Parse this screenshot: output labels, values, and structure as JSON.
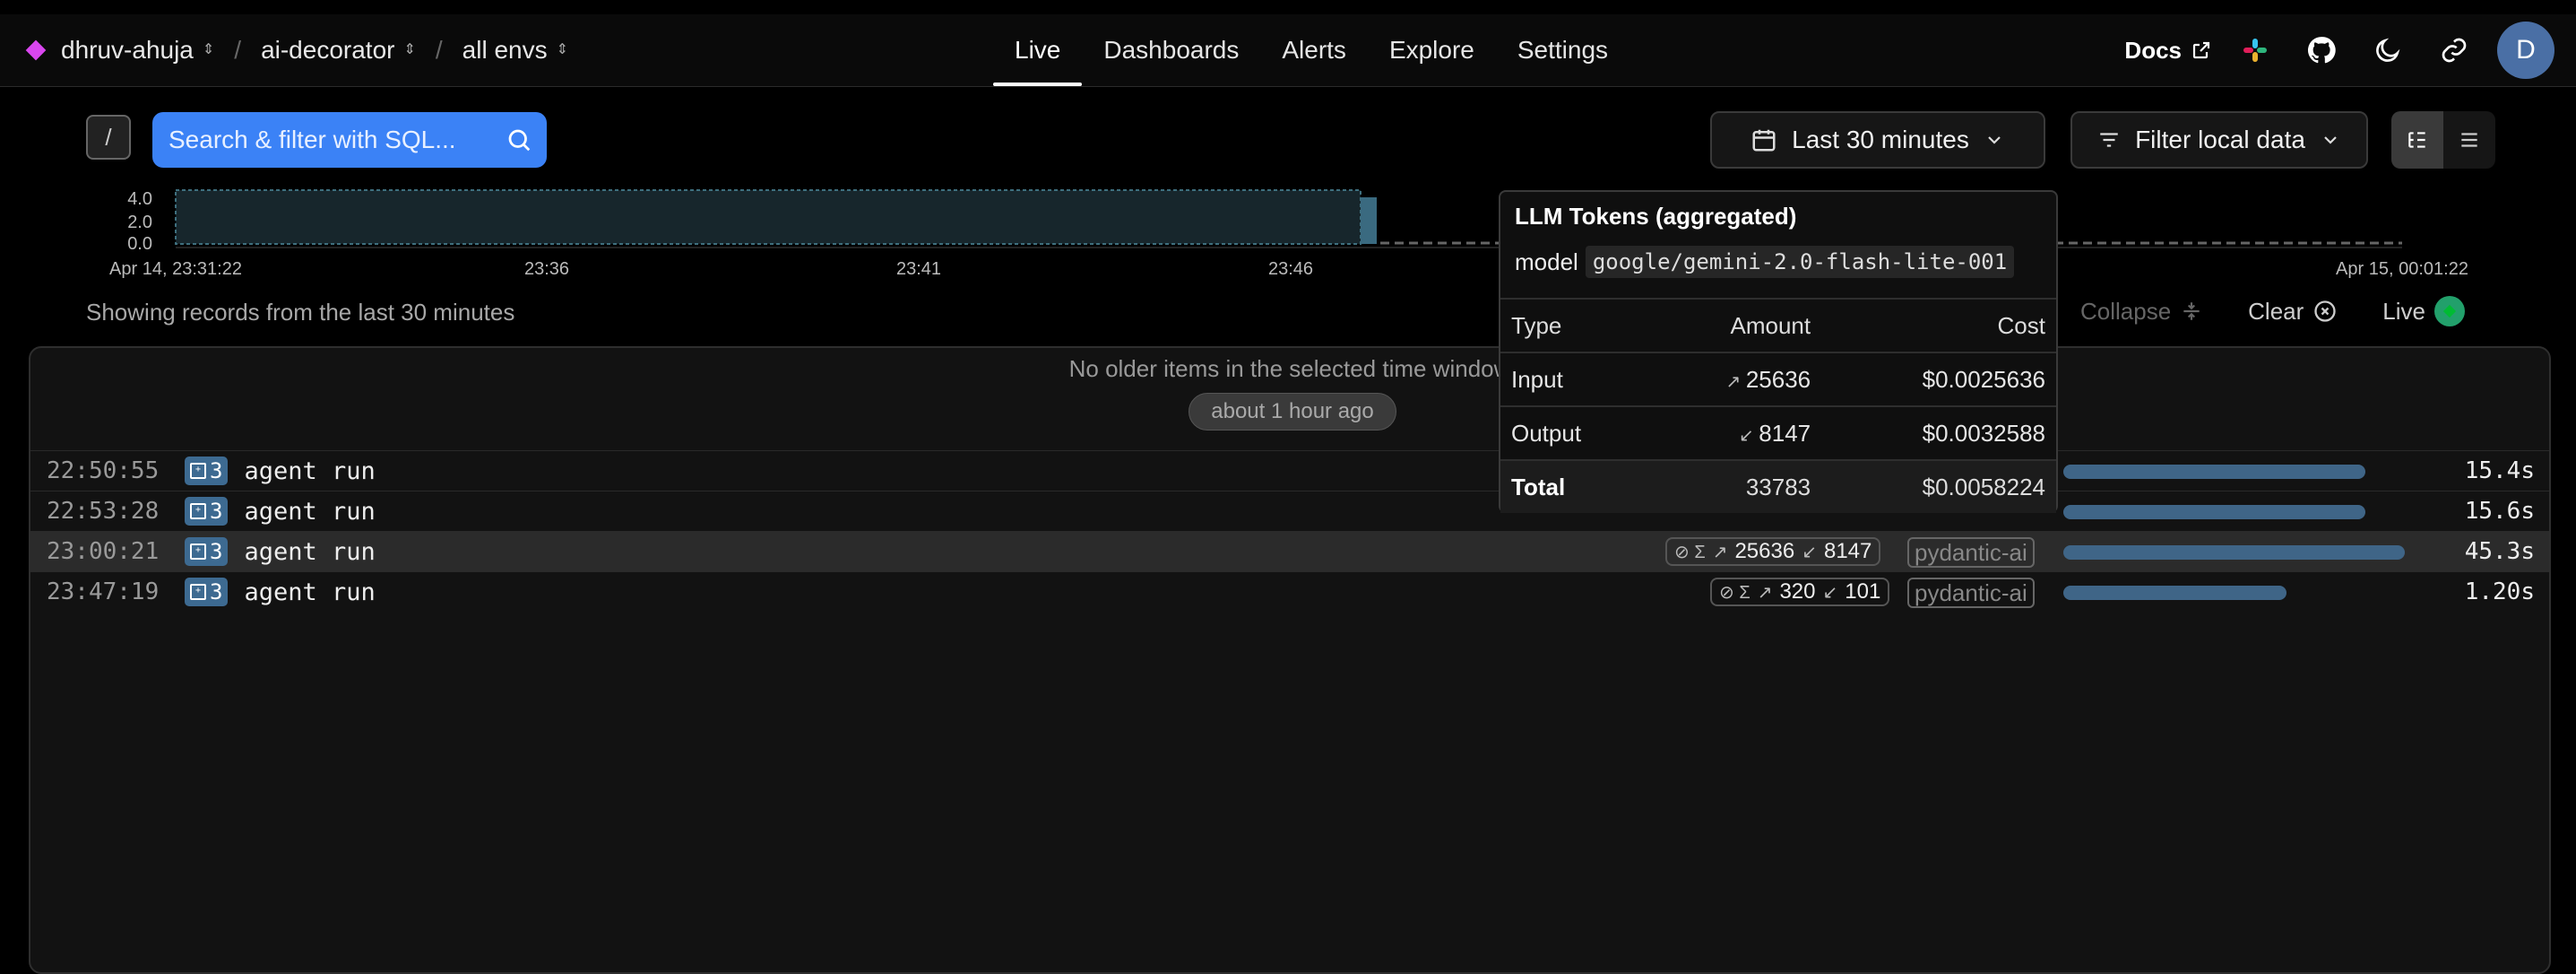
{
  "breadcrumb": {
    "org": "dhruv-ahuja",
    "project": "ai-decorator",
    "env": "all envs"
  },
  "nav": {
    "live": "Live",
    "dashboards": "Dashboards",
    "alerts": "Alerts",
    "explore": "Explore",
    "settings": "Settings"
  },
  "header_tools": {
    "docs": "Docs",
    "avatar_initial": "D"
  },
  "toolbar": {
    "slash_key": "/",
    "search_placeholder": "Search & filter with SQL...",
    "time_range": "Last 30 minutes",
    "filter_label": "Filter local data"
  },
  "histogram": {
    "y_ticks": [
      "4.0",
      "2.0",
      "0.0"
    ],
    "x_ticks": [
      "Apr 14, 23:31:22",
      "23:36",
      "23:41",
      "23:46",
      "Apr 15, 00:01:22"
    ]
  },
  "status": {
    "showing": "Showing records from the last 30 minutes",
    "collapse": "Collapse",
    "clear": "Clear",
    "live": "Live"
  },
  "panel": {
    "older": "No older items in the selected time window",
    "ago": "about 1 hour ago"
  },
  "rows": [
    {
      "time": "22:50:55",
      "count": "3",
      "name": "agent run",
      "tokens_in": "",
      "tokens_out": "",
      "tag": "",
      "duration": "15.4s",
      "bar": 0.77
    },
    {
      "time": "22:53:28",
      "count": "3",
      "name": "agent run",
      "tokens_in": "",
      "tokens_out": "",
      "tag": "",
      "duration": "15.6s",
      "bar": 0.77
    },
    {
      "time": "23:00:21",
      "count": "3",
      "name": "agent run",
      "tokens_in": "25636",
      "tokens_out": "8147",
      "tag": "pydantic-ai",
      "duration": "45.3s",
      "bar": 0.87
    },
    {
      "time": "23:47:19",
      "count": "3",
      "name": "agent run",
      "tokens_in": "320",
      "tokens_out": "101",
      "tag": "pydantic-ai",
      "duration": "1.20s",
      "bar": 0.57
    }
  ],
  "tooltip": {
    "title": "LLM Tokens (aggregated)",
    "model_label": "model",
    "model_value": "google/gemini-2.0-flash-lite-001",
    "headers": {
      "type": "Type",
      "amount": "Amount",
      "cost": "Cost"
    },
    "rows": [
      {
        "type": "Input",
        "amount": "25636",
        "cost": "$0.0025636"
      },
      {
        "type": "Output",
        "amount": "8147",
        "cost": "$0.0032588"
      }
    ],
    "total": {
      "type": "Total",
      "amount": "33783",
      "cost": "$0.0058224"
    }
  },
  "colors": {
    "accent": "#3b82f6",
    "live": "#22a06b",
    "bar": "#3f6587",
    "brand": "#d946ef"
  }
}
